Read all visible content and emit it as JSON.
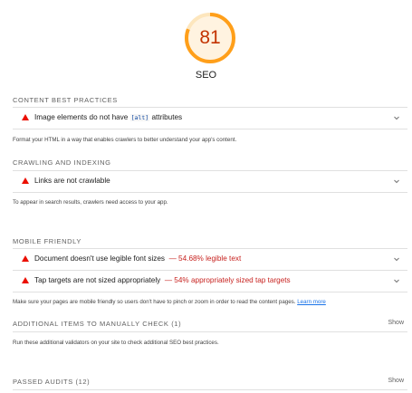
{
  "gauge": {
    "score": "81",
    "score_fraction": 0.81,
    "label": "SEO",
    "color": "#ff9f1a",
    "track_color": "#fde6bd"
  },
  "sections": {
    "content": {
      "title": "CONTENT BEST PRACTICES",
      "audit": {
        "prefix": "Image elements do not have ",
        "code": "[alt]",
        "suffix": " attributes"
      },
      "description": "Format your HTML in a way that enables crawlers to better understand your app's content."
    },
    "crawling": {
      "title": "CRAWLING AND INDEXING",
      "audit": {
        "text": "Links are not crawlable"
      },
      "description": "To appear in search results, crawlers need access to your app."
    },
    "mobile": {
      "title": "MOBILE FRIENDLY",
      "audits": [
        {
          "text": "Document doesn't use legible font sizes",
          "display": "— 54.68% legible text"
        },
        {
          "text": "Tap targets are not sized appropriately",
          "display": "— 54% appropriately sized tap targets"
        }
      ],
      "description": "Make sure your pages are mobile friendly so users don't have to pinch or zoom in order to read the content pages.",
      "link": "Learn more"
    },
    "manual": {
      "title": "ADDITIONAL ITEMS TO MANUALLY CHECK (1)",
      "show": "Show",
      "description": "Run these additional validators on your site to check additional SEO best practices."
    },
    "passed": {
      "title": "PASSED AUDITS (12)",
      "show": "Show"
    }
  },
  "icons": {
    "fail": "warning-triangle-icon",
    "expand": "chevron-down-icon"
  },
  "colors": {
    "fail": "#eb0f00",
    "score_text": "#c33300",
    "link": "#1a73e8"
  }
}
